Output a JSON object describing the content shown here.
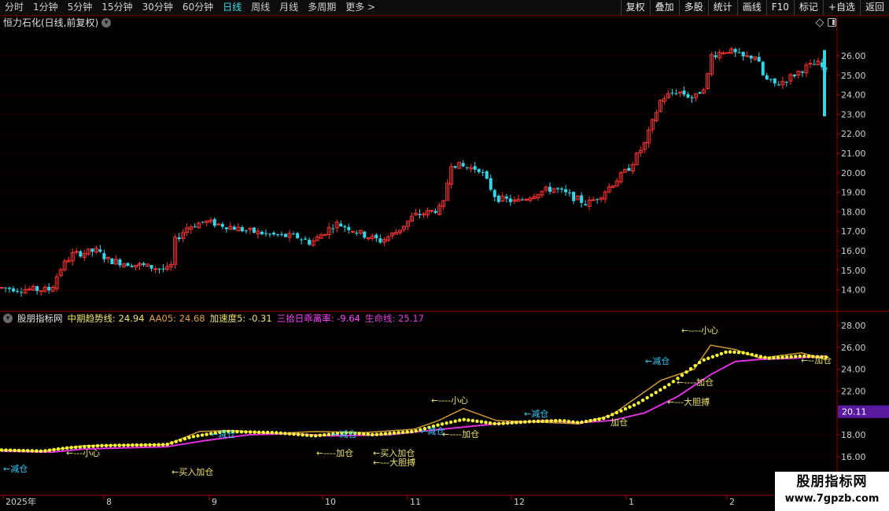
{
  "toolbar": {
    "periods": [
      {
        "label": "分时",
        "active": false
      },
      {
        "label": "1分钟",
        "active": false
      },
      {
        "label": "5分钟",
        "active": false
      },
      {
        "label": "15分钟",
        "active": false
      },
      {
        "label": "30分钟",
        "active": false
      },
      {
        "label": "60分钟",
        "active": false
      },
      {
        "label": "日线",
        "active": true
      },
      {
        "label": "周线",
        "active": false
      },
      {
        "label": "月线",
        "active": false
      },
      {
        "label": "多周期",
        "active": false
      },
      {
        "label": "更多",
        "active": false
      }
    ],
    "right_buttons": [
      "复权",
      "叠加",
      "多股",
      "统计",
      "画线",
      "F10",
      "标记",
      "+自选",
      "返回"
    ]
  },
  "chart_title": "恒力石化(日线,前复权)",
  "price_axis": [
    "26.00",
    "25.00",
    "24.00",
    "23.00",
    "22.00",
    "21.00",
    "20.00",
    "19.00",
    "18.00",
    "17.00",
    "16.00",
    "15.00",
    "14.00"
  ],
  "indicator": {
    "name": "股朋指标网",
    "items": [
      {
        "label": "中期趋势线: 24.94",
        "color": "#f0e66c"
      },
      {
        "label": "AA05: 24.68",
        "color": "#e0a040"
      },
      {
        "label": "加速度5: -0.31",
        "color": "#f0e66c"
      },
      {
        "label": "三拾日乖离率: -9.64",
        "color": "#ff44ff"
      },
      {
        "label": "生命线: 25.17",
        "color": "#e040e0"
      }
    ],
    "axis": [
      "28.00",
      "26.00",
      "24.00",
      "22.00",
      "20.00",
      "18.00",
      "16.00"
    ],
    "current_value": "20.11"
  },
  "annotations": [
    {
      "text": "←减仓",
      "color": "#30d0ff"
    },
    {
      "text": "←买入加仓",
      "color": "#f0e66c"
    },
    {
      "text": "←---小心",
      "color": "#f0e66c"
    },
    {
      "text": "←减仓",
      "color": "#30d0ff"
    },
    {
      "text": "←----加仓",
      "color": "#f0e66c"
    },
    {
      "text": "←减仓",
      "color": "#30d0ff"
    },
    {
      "text": "←买入加仓",
      "color": "#f0e66c"
    },
    {
      "text": "←---大胆搏",
      "color": "#f0e66c"
    },
    {
      "text": "←减仓",
      "color": "#30d0ff"
    },
    {
      "text": "←----小心",
      "color": "#f0e66c"
    },
    {
      "text": "←----加仓",
      "color": "#f0e66c"
    },
    {
      "text": "←减仓",
      "color": "#30d0ff"
    },
    {
      "text": "加仓",
      "color": "#f0e66c"
    },
    {
      "text": "←---大胆搏",
      "color": "#f0e66c"
    },
    {
      "text": "←----加仓",
      "color": "#f0e66c"
    },
    {
      "text": "←减仓",
      "color": "#30d0ff"
    },
    {
      "text": "←----小心",
      "color": "#f0e66c"
    },
    {
      "text": "←--加仓",
      "color": "#f0e66c"
    }
  ],
  "date_axis": [
    "2025年",
    "8",
    "9",
    "10",
    "11",
    "12",
    "1",
    "2"
  ],
  "watermark": {
    "title": "股朋指标网",
    "url": "www.7gpzb.com"
  },
  "colors": {
    "up": "#ff3232",
    "down": "#2fd8e8",
    "grid": "#5a0000",
    "axis": "#a00000"
  }
}
